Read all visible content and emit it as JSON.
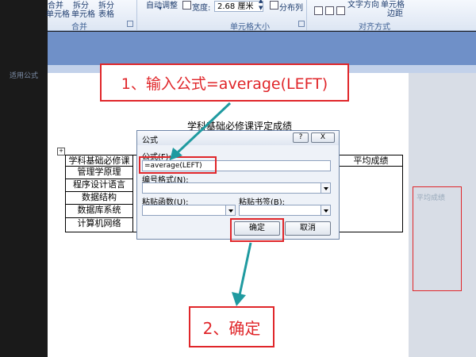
{
  "ribbon": {
    "top_left_labels": [
      "合并",
      "拆分",
      "拆分"
    ],
    "mid_labels": [
      "单元格",
      "单元格",
      "表格"
    ],
    "autofit_label": "自动调整",
    "width_label": "宽度:",
    "width_value": "2.68 厘米",
    "distribute_cols_label": "分布列",
    "text_direction_label": "文字方向",
    "cell_margins_label": "单元格",
    "cell_margins_label2": "边距",
    "groups": {
      "merge": "合并",
      "cell_size": "单元格大小",
      "alignment": "对齐方式"
    }
  },
  "left_ghost_text": "适用公式",
  "right_ghost_text": "平均成绩",
  "callouts": {
    "step1": "1、输入公式=average(LEFT)",
    "step2": "2、确定"
  },
  "document": {
    "title": "学科基础必修课评定成绩",
    "table": {
      "header_first": "学科基础必修课",
      "header_last": "平均成绩",
      "rows": [
        "管理学原理",
        "程序设计语言",
        "数据结构",
        "数据库系统",
        "计算机网络"
      ]
    }
  },
  "dialog": {
    "title": "公式",
    "help_label": "?",
    "close_label": "X",
    "formula_label": "公式(F):",
    "formula_value": "=average(LEFT)",
    "number_format_label": "编号格式(N):",
    "paste_function_label": "粘贴函数(U):",
    "paste_bookmark_label": "粘贴书签(B):",
    "ok_label": "确定",
    "cancel_label": "取消"
  },
  "colors": {
    "accent_red": "#e0262a",
    "arrow_teal": "#1f9aa0",
    "ribbon_band": "#6f90c8"
  }
}
